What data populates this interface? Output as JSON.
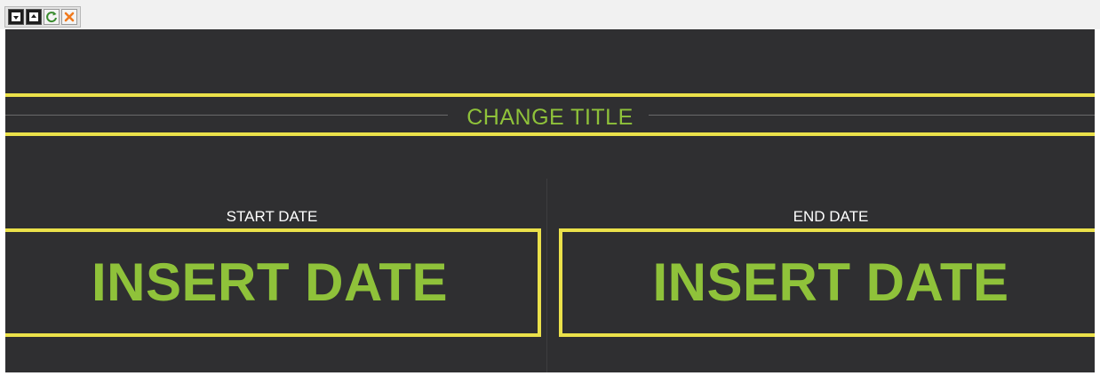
{
  "toolbar": {
    "buttons": [
      {
        "icon": "move-down-icon"
      },
      {
        "icon": "move-up-icon"
      },
      {
        "icon": "refresh-icon"
      },
      {
        "icon": "close-icon"
      }
    ]
  },
  "banner": {
    "title": "CHANGE TITLE",
    "colors": {
      "background": "#2f2f31",
      "accent_yellow": "#ebe14a",
      "accent_green": "#8fc23a",
      "label_white": "#ffffff"
    }
  },
  "start": {
    "label": "START DATE",
    "value": "INSERT DATE"
  },
  "end": {
    "label": "END DATE",
    "value": "INSERT DATE"
  }
}
